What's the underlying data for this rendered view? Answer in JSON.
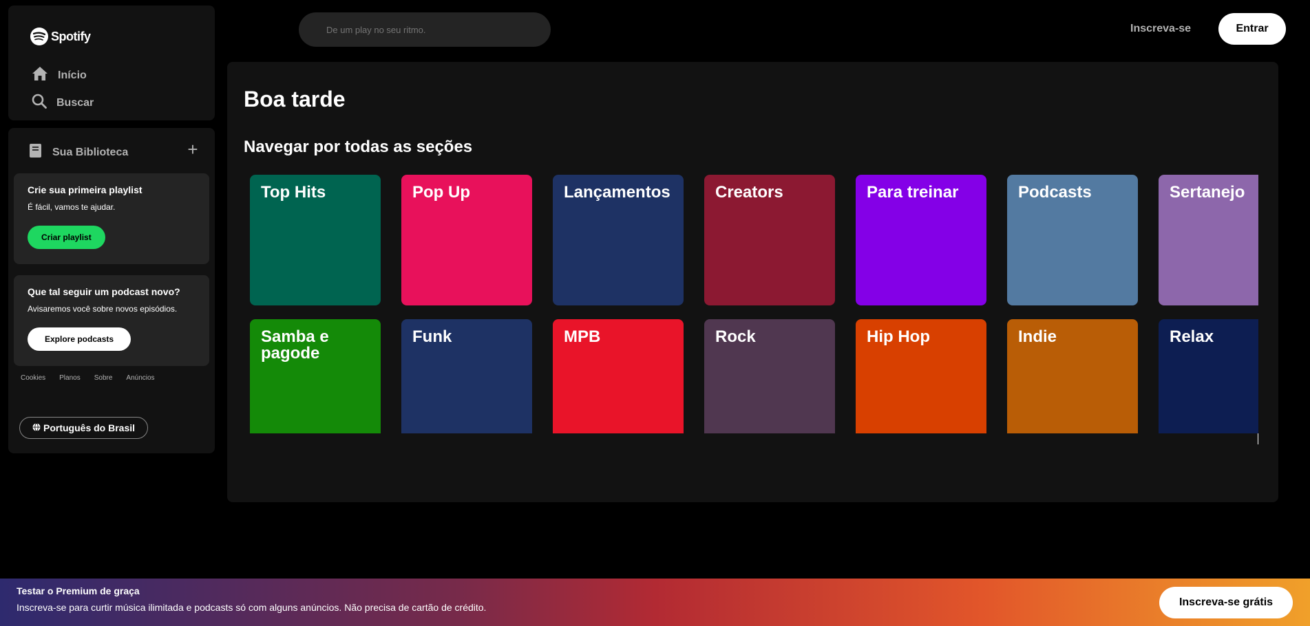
{
  "brand": {
    "name": "Spotify"
  },
  "nav": {
    "home_label": "Início",
    "search_label": "Buscar"
  },
  "library": {
    "title": "Sua Biblioteca",
    "add_icon": "plus-icon",
    "playlist_card": {
      "title": "Crie sua primeira playlist",
      "subtitle": "É fácil, vamos te ajudar.",
      "button": "Criar playlist"
    },
    "podcast_card": {
      "title": "Que tal seguir um podcast novo?",
      "subtitle": "Avisaremos você sobre novos episódios.",
      "button": "Explore podcasts"
    },
    "footer_links": [
      "Cookies",
      "Planos",
      "Sobre",
      "Anúncios"
    ],
    "language_button": "Português do Brasil"
  },
  "topbar": {
    "search_placeholder": "De um play no seu ritmo.",
    "signup": "Inscreva-se",
    "login": "Entrar"
  },
  "main": {
    "greeting": "Boa tarde",
    "section_title": "Navegar por todas as seções",
    "categories": [
      {
        "label": "Top Hits",
        "color": "#006450"
      },
      {
        "label": "Pop Up",
        "color": "#e8115b"
      },
      {
        "label": "Lançamentos",
        "color": "#1e3264"
      },
      {
        "label": "Creators",
        "color": "#8c1932"
      },
      {
        "label": "Para treinar",
        "color": "#8400e7"
      },
      {
        "label": "Podcasts",
        "color": "#537aa1"
      },
      {
        "label": "Sertanejo",
        "color": "#8d67ab"
      },
      {
        "label": "Samba e pagode",
        "color": "#148a08"
      },
      {
        "label": "Funk",
        "color": "#1e3264"
      },
      {
        "label": "MPB",
        "color": "#e91429"
      },
      {
        "label": "Rock",
        "color": "#503750"
      },
      {
        "label": "Hip Hop",
        "color": "#d84000"
      },
      {
        "label": "Indie",
        "color": "#b95d06"
      },
      {
        "label": "Relax",
        "color": "#0d1e52"
      }
    ]
  },
  "banner": {
    "title": "Testar o Premium de graça",
    "subtitle": "Inscreva-se para curtir música ilimitada e podcasts só com alguns anúncios. Não precisa de cartão de crédito.",
    "button": "Inscreva-se grátis"
  },
  "colors": {
    "accent_green": "#1ed760",
    "panel": "#121212",
    "card": "#242424"
  }
}
